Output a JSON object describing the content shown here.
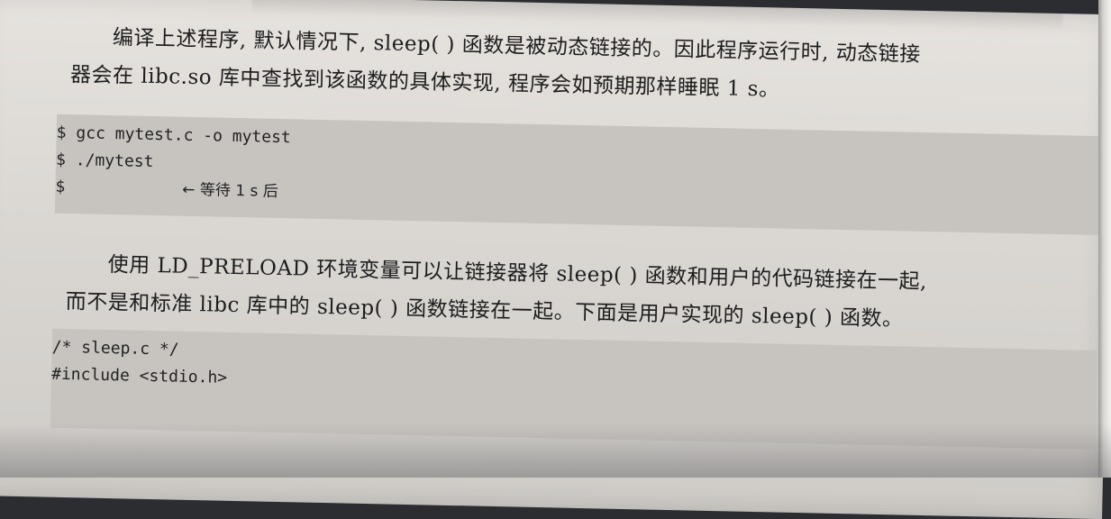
{
  "paragraph1": {
    "line1": "编译上述程序, 默认情况下, sleep( ) 函数是被动态链接的。因此程序运行时, 动态链接",
    "line2": "器会在 libc.so 库中查找到该函数的具体实现, 程序会如预期那样睡眠 1 s。"
  },
  "code_block1": {
    "lines": [
      "$ gcc mytest.c -o mytest",
      "$ ./mytest",
      "$"
    ],
    "comment": "← 等待 1 s 后"
  },
  "paragraph2": {
    "line1": "使用 LD_PRELOAD 环境变量可以让链接器将 sleep( ) 函数和用户的代码链接在一起,",
    "line2": "而不是和标准 libc 库中的 sleep( ) 函数链接在一起。下面是用户实现的 sleep( ) 函数。"
  },
  "code_block2": {
    "lines": [
      "/* sleep.c */",
      "#include <stdio.h>"
    ]
  }
}
